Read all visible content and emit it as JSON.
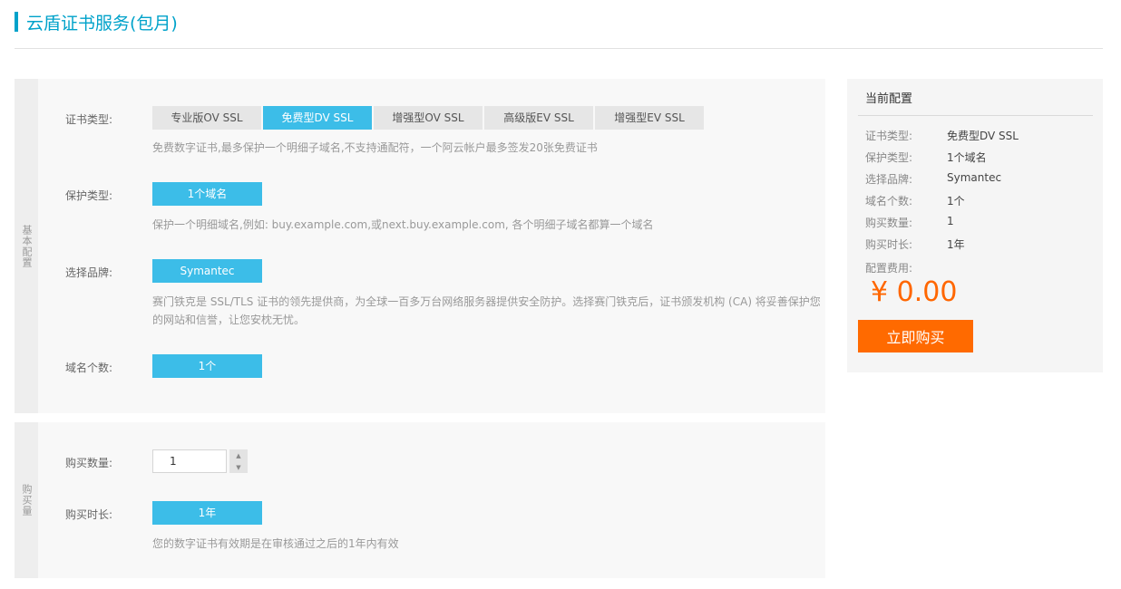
{
  "page": {
    "title": "云盾证书服务(包月)"
  },
  "basic": {
    "section_label": "基本配置",
    "cert_type": {
      "label": "证书类型:",
      "options": [
        "专业版OV SSL",
        "免费型DV SSL",
        "增强型OV SSL",
        "高级版EV SSL",
        "增强型EV SSL"
      ],
      "selected_index": 1,
      "desc": "免费数字证书,最多保护一个明细子域名,不支持通配符，一个阿云帐户最多签发20张免费证书"
    },
    "protect_type": {
      "label": "保护类型:",
      "value": "1个域名",
      "desc": "保护一个明细域名,例如: buy.example.com,或next.buy.example.com, 各个明细子域名都算一个域名"
    },
    "brand": {
      "label": "选择品牌:",
      "value": "Symantec",
      "desc_line1": "赛门铁克是 SSL/TLS 证书的领先提供商，为全球一百多万台网络服务器提供安全防护。选择赛门铁克后，证书颁发机构 (CA) 将妥善保护您",
      "desc_line2": "的网站和信誉，让您安枕无忧。"
    },
    "domain_count": {
      "label": "域名个数:",
      "value": "1个"
    }
  },
  "purchase": {
    "section_label": "购买量",
    "quantity": {
      "label": "购买数量:",
      "value": "1"
    },
    "duration": {
      "label": "购买时长:",
      "value": "1年",
      "desc": "您的数字证书有效期是在审核通过之后的1年内有效"
    }
  },
  "summary": {
    "title": "当前配置",
    "rows": [
      {
        "key": "证书类型:",
        "value": "免费型DV SSL"
      },
      {
        "key": "保护类型:",
        "value": "1个域名"
      },
      {
        "key": "选择品牌:",
        "value": "Symantec"
      },
      {
        "key": "域名个数:",
        "value": "1个"
      },
      {
        "key": "购买数量:",
        "value": "1"
      },
      {
        "key": "购买时长:",
        "value": "1年"
      }
    ],
    "fee_label": "配置费用:",
    "fee_value": "¥ 0.00",
    "buy_label": "立即购买"
  },
  "colors": {
    "accent": "#00a2ca",
    "selected": "#3cbde8",
    "price": "#ff6600",
    "buy_button": "#ff6a00"
  },
  "icons": {
    "stepper_up": "caret-up-icon",
    "stepper_down": "caret-down-icon"
  }
}
